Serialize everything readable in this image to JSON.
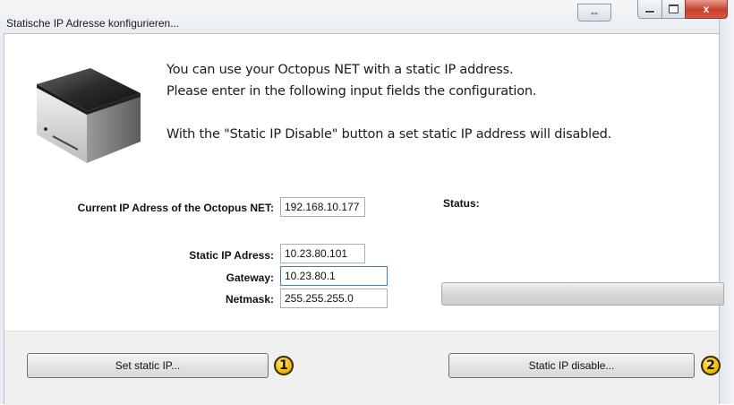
{
  "window": {
    "title": "Statische IP Adresse konfigurieren...",
    "move_glyph": "⇔",
    "close_glyph": "x"
  },
  "intro": {
    "line1": "You can use your Octopus NET with a static IP address.",
    "line2": "Please enter in the following input fields the configuration.",
    "line3": "With the \"Static IP Disable\" button a set static IP address will disabled."
  },
  "form": {
    "current_ip_label": "Current IP Adress of the Octopus NET:",
    "current_ip_value": "192.168.10.177",
    "static_ip_label": "Static IP Adress:",
    "static_ip_value": "10.23.80.101",
    "gateway_label": "Gateway:",
    "gateway_value": "10.23.80.1",
    "netmask_label": "Netmask:",
    "netmask_value": "255.255.255.0"
  },
  "status": {
    "label": "Status:",
    "progress_fraction": 0
  },
  "buttons": {
    "set_static_ip": "Set static IP...",
    "static_ip_disable": "Static IP disable...",
    "badge1": "1",
    "badge2": "2"
  },
  "colors": {
    "close_button": "#c7402b",
    "badge": "#f2b600",
    "focus_border": "#3c7fb1"
  },
  "icons": {
    "device": "octopus-net-device-icon",
    "move": "resize-arrows-icon",
    "minimize": "minimize-icon",
    "maximize": "maximize-icon",
    "close": "close-icon"
  }
}
